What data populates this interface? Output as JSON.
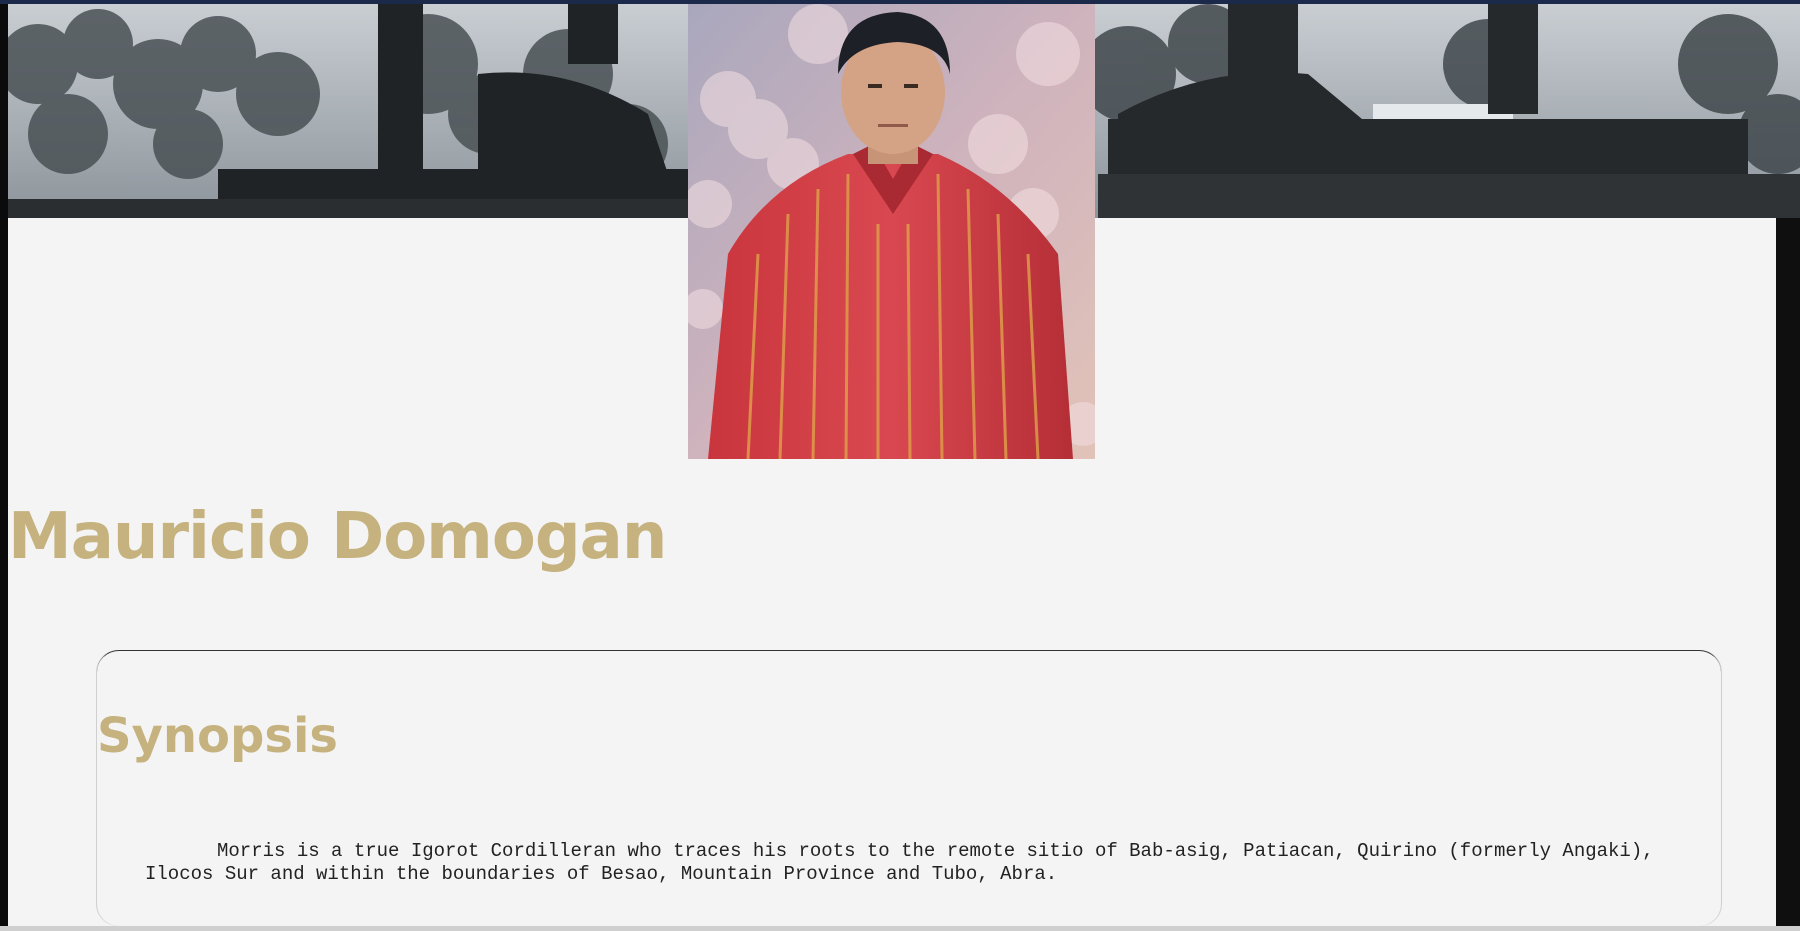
{
  "profile": {
    "name": "Mauricio Domogan",
    "portrait_icon": "person-portrait",
    "banner_icon": "stone-statues-banner"
  },
  "synopsis": {
    "title": "Synopsis",
    "text": "Morris is a true Igorot Cordilleran who traces his roots to the remote sitio of Bab-asig, Patiacan, Quirino (formerly Angaki), Ilocos Sur and within the boundaries of Besao, Mountain Province and Tubo, Abra."
  },
  "colors": {
    "heading": "#c5b27f",
    "page_background": "#f4f4f4",
    "text": "#222222"
  }
}
